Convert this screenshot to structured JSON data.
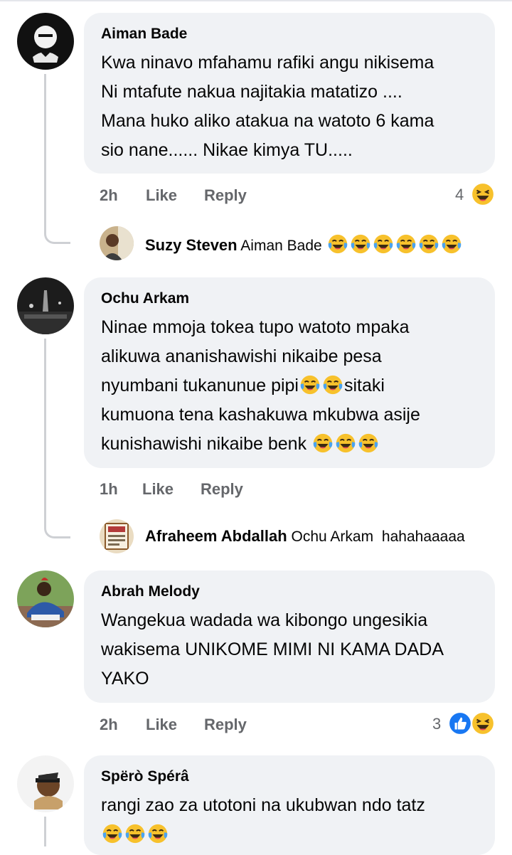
{
  "comments": [
    {
      "author": "Aiman Bade",
      "lines": [
        "Kwa ninavo mfahamu rafiki angu nikisema",
        "Ni mtafute nakua najitakia  matatizo ....",
        "Mana huko aliko atakua na watoto 6 kama",
        "sio nane...... Nikae kimya TU....."
      ],
      "time": "2h",
      "like": "Like",
      "reply": "Reply",
      "reaction_count": "4",
      "reactions": [
        "haha-icon"
      ],
      "sub_reply": {
        "author": "Suzy Steven",
        "mention": "Aiman Bade",
        "text": "",
        "emoji": [
          "tears-of-joy-icon",
          "tears-of-joy-icon",
          "tears-of-joy-icon",
          "tears-of-joy-icon",
          "tears-of-joy-icon",
          "tears-of-joy-icon"
        ]
      }
    },
    {
      "author": "Ochu Arkam",
      "lines": [
        "Ninae mmoja tokea tupo watoto mpaka",
        "alikuwa ananishawishi nikaibe pesa",
        "nyumbani tukanunue pipi",
        "sitaki",
        "kumuona tena kashakuwa mkubwa asije",
        "kunishawishi nikaibe benk "
      ],
      "time": "1h",
      "like": "Like",
      "reply": "Reply",
      "sub_reply": {
        "author": "Afraheem Abdallah",
        "mention": "Ochu Arkam",
        "text": "hahahaaaaa"
      }
    },
    {
      "author": "Abrah Melody",
      "lines": [
        "Wangekua wadada wa kibongo ungesikia",
        "wakisema UNIKOME MIMI NI KAMA DADA",
        "YAKO"
      ],
      "time": "2h",
      "like": "Like",
      "reply": "Reply",
      "reaction_count": "3",
      "reactions": [
        "like-icon",
        "haha-icon"
      ]
    },
    {
      "author": "Spërò Spérâ",
      "lines": [
        "rangi zao za utotoni na ukubwan ndo tatz"
      ]
    }
  ],
  "colors": {
    "bubble": "#f0f2f5",
    "meta_text": "#65676b",
    "like_blue": "#1877f2",
    "emoji_yellow": "#f7c12c"
  }
}
